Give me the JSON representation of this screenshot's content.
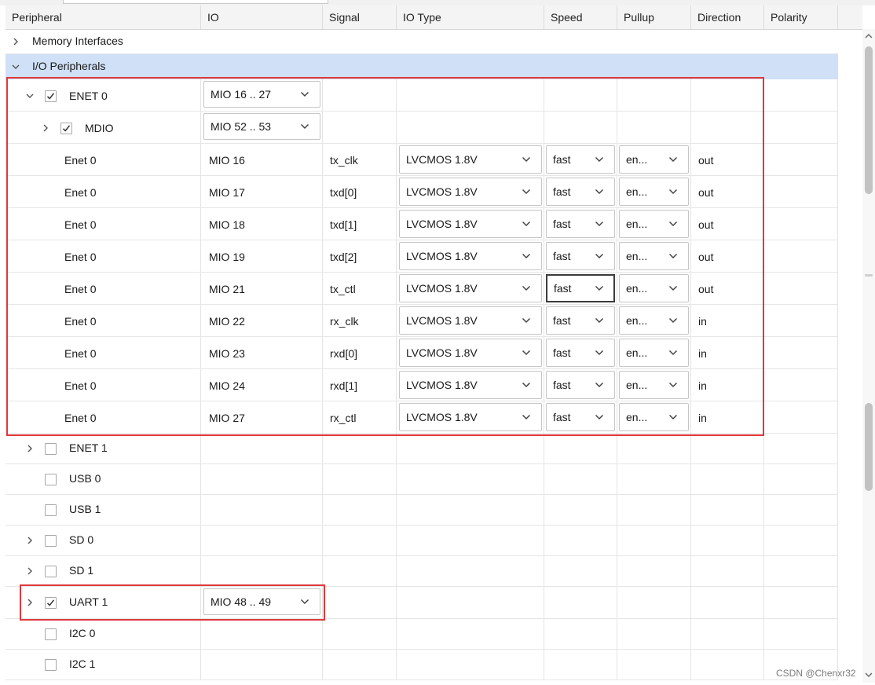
{
  "headers": [
    "Peripheral",
    "IO",
    "Signal",
    "IO Type",
    "Speed",
    "Pullup",
    "Direction",
    "Polarity"
  ],
  "groups": [
    {
      "label": "Memory Interfaces",
      "expanded": false,
      "selected": false
    },
    {
      "label": "I/O Peripherals",
      "expanded": true,
      "selected": true
    }
  ],
  "enet0": {
    "label": "ENET 0",
    "checked": true,
    "expanded": true,
    "io": "MIO 16 .. 27"
  },
  "mdio": {
    "label": "MDIO",
    "checked": true,
    "expanded": false,
    "io": "MIO 52 .. 53"
  },
  "pins": [
    {
      "peripheral": "Enet 0",
      "io": "MIO 16",
      "signal": "tx_clk",
      "io_type": "LVCMOS 1.8V",
      "speed": "fast",
      "pullup": "en...",
      "direction": "out"
    },
    {
      "peripheral": "Enet 0",
      "io": "MIO 17",
      "signal": "txd[0]",
      "io_type": "LVCMOS 1.8V",
      "speed": "fast",
      "pullup": "en...",
      "direction": "out"
    },
    {
      "peripheral": "Enet 0",
      "io": "MIO 18",
      "signal": "txd[1]",
      "io_type": "LVCMOS 1.8V",
      "speed": "fast",
      "pullup": "en...",
      "direction": "out"
    },
    {
      "peripheral": "Enet 0",
      "io": "MIO 19",
      "signal": "txd[2]",
      "io_type": "LVCMOS 1.8V",
      "speed": "fast",
      "pullup": "en...",
      "direction": "out"
    },
    {
      "peripheral": "Enet 0",
      "io": "MIO 21",
      "signal": "tx_ctl",
      "io_type": "LVCMOS 1.8V",
      "speed": "fast",
      "pullup": "en...",
      "direction": "out",
      "speed_focused": true
    },
    {
      "peripheral": "Enet 0",
      "io": "MIO 22",
      "signal": "rx_clk",
      "io_type": "LVCMOS 1.8V",
      "speed": "fast",
      "pullup": "en...",
      "direction": "in"
    },
    {
      "peripheral": "Enet 0",
      "io": "MIO 23",
      "signal": "rxd[0]",
      "io_type": "LVCMOS 1.8V",
      "speed": "fast",
      "pullup": "en...",
      "direction": "in"
    },
    {
      "peripheral": "Enet 0",
      "io": "MIO 24",
      "signal": "rxd[1]",
      "io_type": "LVCMOS 1.8V",
      "speed": "fast",
      "pullup": "en...",
      "direction": "in"
    },
    {
      "peripheral": "Enet 0",
      "io": "MIO 27",
      "signal": "rx_ctl",
      "io_type": "LVCMOS 1.8V",
      "speed": "fast",
      "pullup": "en...",
      "direction": "in"
    }
  ],
  "others": [
    {
      "label": "ENET 1",
      "checked": false,
      "expandable": true,
      "io": ""
    },
    {
      "label": "USB 0",
      "checked": false,
      "expandable": false,
      "io": ""
    },
    {
      "label": "USB 1",
      "checked": false,
      "expandable": false,
      "io": ""
    },
    {
      "label": "SD 0",
      "checked": false,
      "expandable": true,
      "io": ""
    },
    {
      "label": "SD 1",
      "checked": false,
      "expandable": true,
      "io": ""
    },
    {
      "label": "UART 1",
      "checked": true,
      "expandable": true,
      "io": "MIO 48 .. 49"
    },
    {
      "label": "I2C 0",
      "checked": false,
      "expandable": false,
      "io": ""
    },
    {
      "label": "I2C 1",
      "checked": false,
      "expandable": false,
      "io": ""
    }
  ],
  "watermark": "CSDN @Chenxr32",
  "colors": {
    "highlight_box": "#e0383c",
    "selected_row": "#cfe0f7"
  }
}
